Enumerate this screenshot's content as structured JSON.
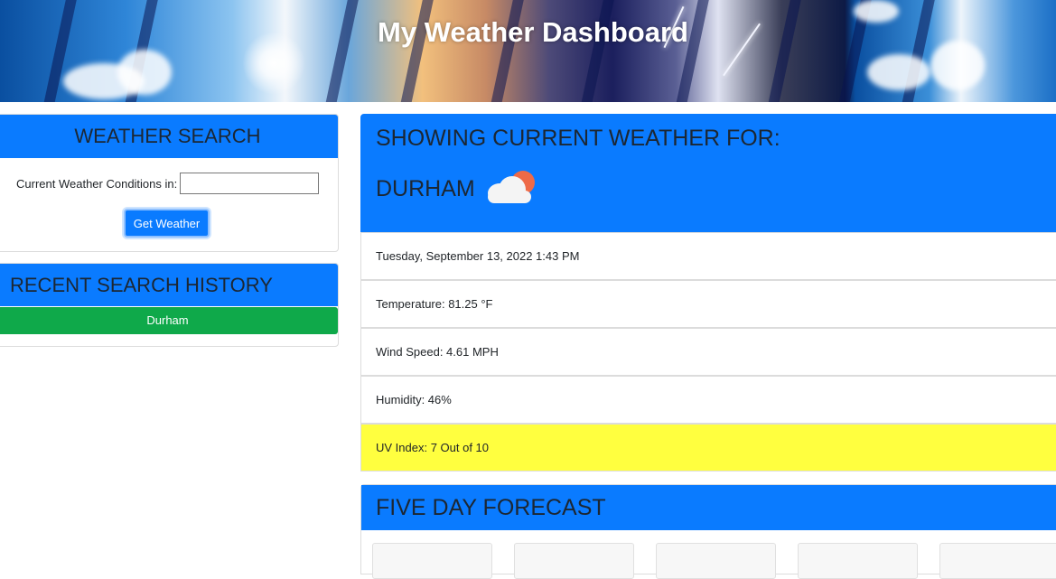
{
  "banner": {
    "title": "My Weather Dashboard"
  },
  "search": {
    "heading": "WEATHER SEARCH",
    "label": "Current Weather Conditions in:",
    "input_value": "",
    "button_label": "Get Weather"
  },
  "history": {
    "heading": "RECENT SEARCH HISTORY",
    "items": [
      "Durham"
    ]
  },
  "current": {
    "heading": "SHOWING CURRENT WEATHER FOR:",
    "city": "DURHAM",
    "icon": "partly-cloudy-icon",
    "datetime": "Tuesday, September 13, 2022 1:43 PM",
    "temperature": "Temperature: 81.25 °F",
    "wind": "Wind Speed: 4.61 MPH",
    "humidity": "Humidity: 46%",
    "uv": "UV Index: 7 Out of 10"
  },
  "forecast": {
    "heading": "FIVE DAY FORECAST"
  },
  "colors": {
    "accent": "#0a7bff",
    "history_button": "#0fa94a",
    "uv_highlight": "#ffff3f"
  }
}
